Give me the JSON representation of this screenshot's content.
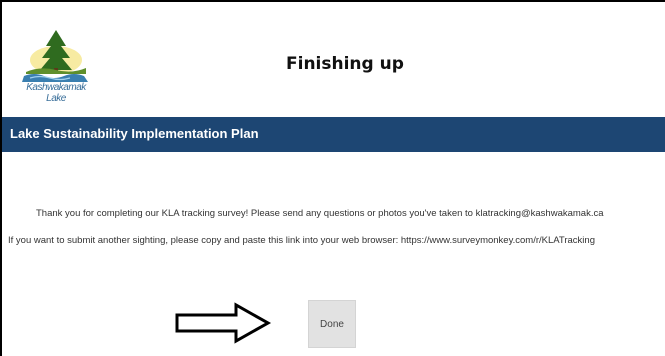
{
  "header": {
    "logo_text": "Kashwakamak Lake",
    "title": "Finishing up"
  },
  "banner": {
    "title": "Lake Sustainability Implementation Plan"
  },
  "main": {
    "message_1": "Thank you for completing our KLA tracking survey! Please send any questions or photos you've taken to klatracking@kashwakamak.ca",
    "message_2": "If you want to submit another sighting, please copy and paste this link into your web browser: https://www.surveymonkey.com/r/KLATracking",
    "done_label": "Done"
  },
  "colors": {
    "banner": "#1d4673",
    "button_bg": "#e2e2e2",
    "tree": "#2f6b1f",
    "water": "#3a7fb0"
  },
  "icons": {
    "logo": "tree-lake-logo",
    "pointer": "right-arrow-icon"
  }
}
